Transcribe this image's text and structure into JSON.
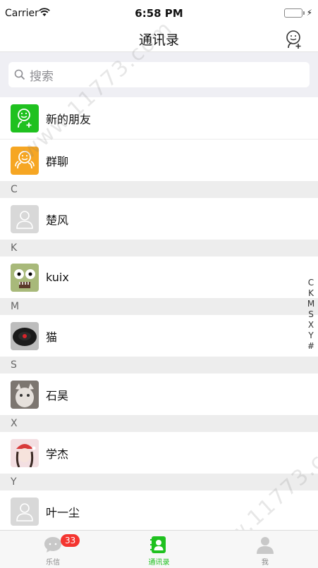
{
  "status": {
    "carrier": "Carrier",
    "time": "6:58 PM"
  },
  "nav": {
    "title": "通讯录"
  },
  "search": {
    "placeholder": "搜索"
  },
  "top_items": [
    {
      "label": "新的朋友",
      "icon": "new-friend-icon",
      "color": "#1fc11f"
    },
    {
      "label": "群聊",
      "icon": "group-chat-icon",
      "color": "#f6a623"
    }
  ],
  "sections": [
    {
      "letter": "C",
      "contacts": [
        {
          "name": "楚风",
          "avatar": "default"
        }
      ]
    },
    {
      "letter": "K",
      "contacts": [
        {
          "name": "kuix",
          "avatar": "photo"
        }
      ]
    },
    {
      "letter": "M",
      "contacts": [
        {
          "name": "猫",
          "avatar": "photo"
        }
      ]
    },
    {
      "letter": "S",
      "contacts": [
        {
          "name": "石昊",
          "avatar": "photo"
        }
      ]
    },
    {
      "letter": "X",
      "contacts": [
        {
          "name": "学杰",
          "avatar": "photo"
        }
      ]
    },
    {
      "letter": "Y",
      "contacts": [
        {
          "name": "叶一尘",
          "avatar": "default"
        }
      ]
    }
  ],
  "index": [
    "C",
    "K",
    "M",
    "S",
    "X",
    "Y",
    "#"
  ],
  "tabs": [
    {
      "label": "乐信",
      "badge": "33",
      "active": false
    },
    {
      "label": "通讯录",
      "active": true
    },
    {
      "label": "我",
      "active": false
    }
  ],
  "watermark": "www.11773.com",
  "colors": {
    "accent": "#1fc11f",
    "badge": "#f43530",
    "group": "#f6a623"
  }
}
